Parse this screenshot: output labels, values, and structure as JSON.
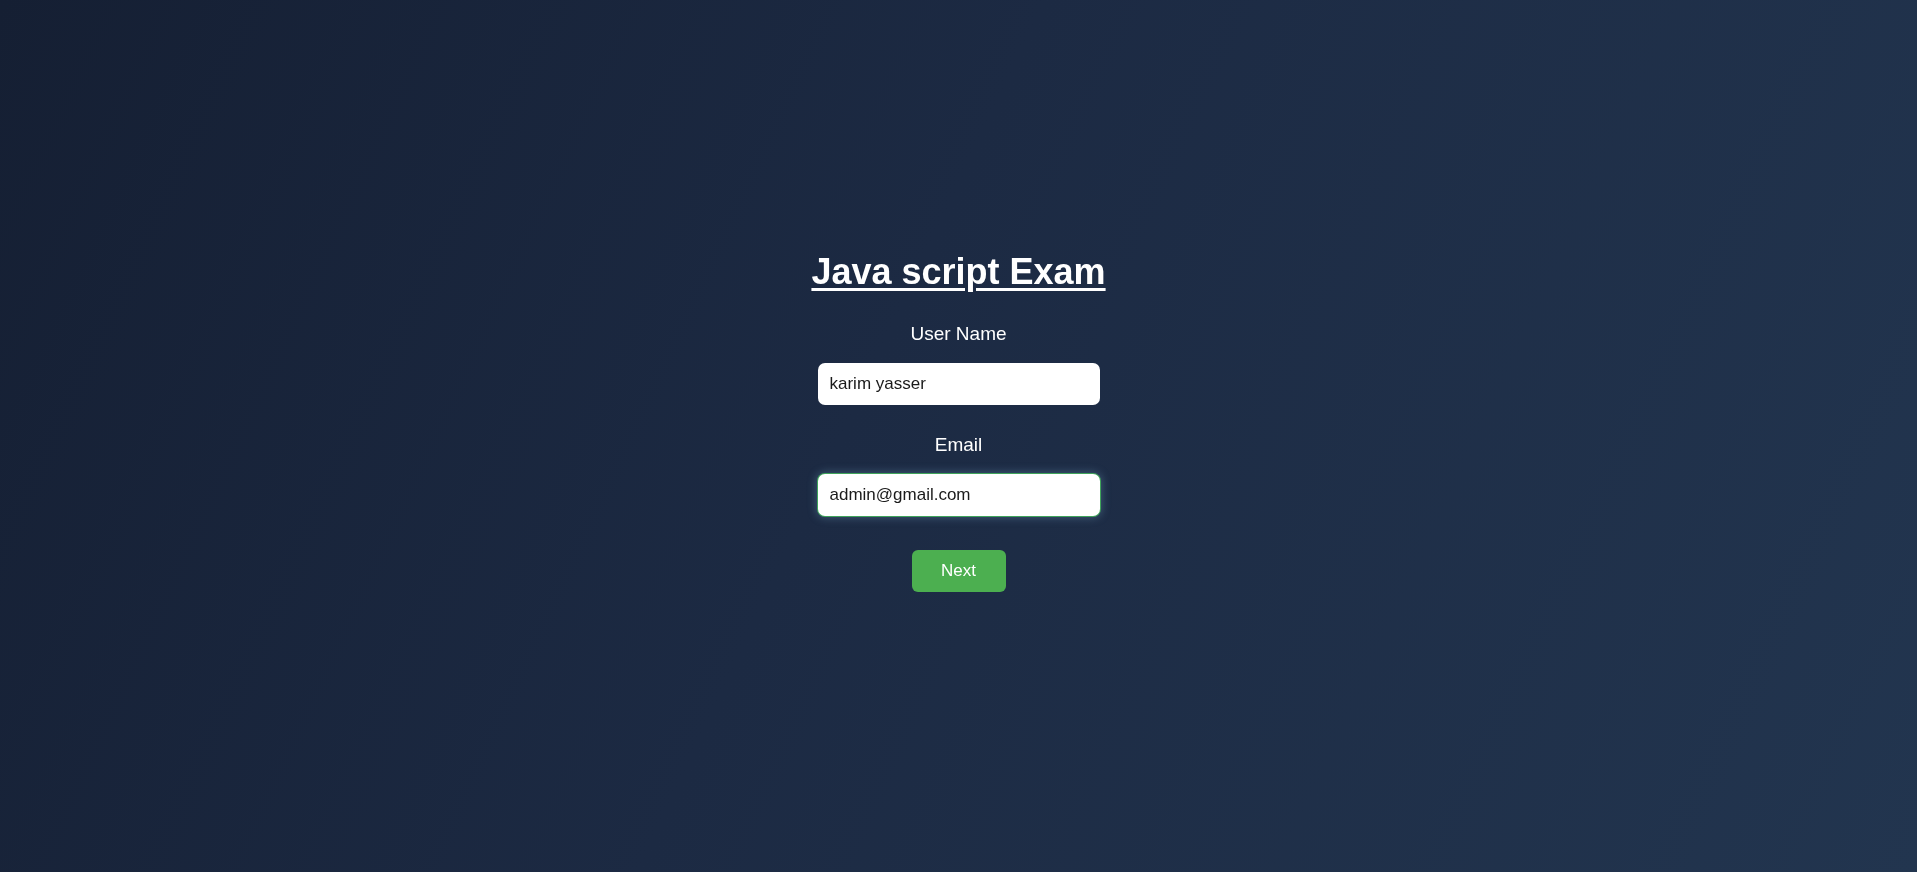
{
  "title": "Java script Exam",
  "fields": [
    {
      "label": "User Name",
      "value": "karim yasser",
      "focused": false
    },
    {
      "label": "Email",
      "value": "admin@gmail.com",
      "focused": true
    }
  ],
  "button": "Next"
}
